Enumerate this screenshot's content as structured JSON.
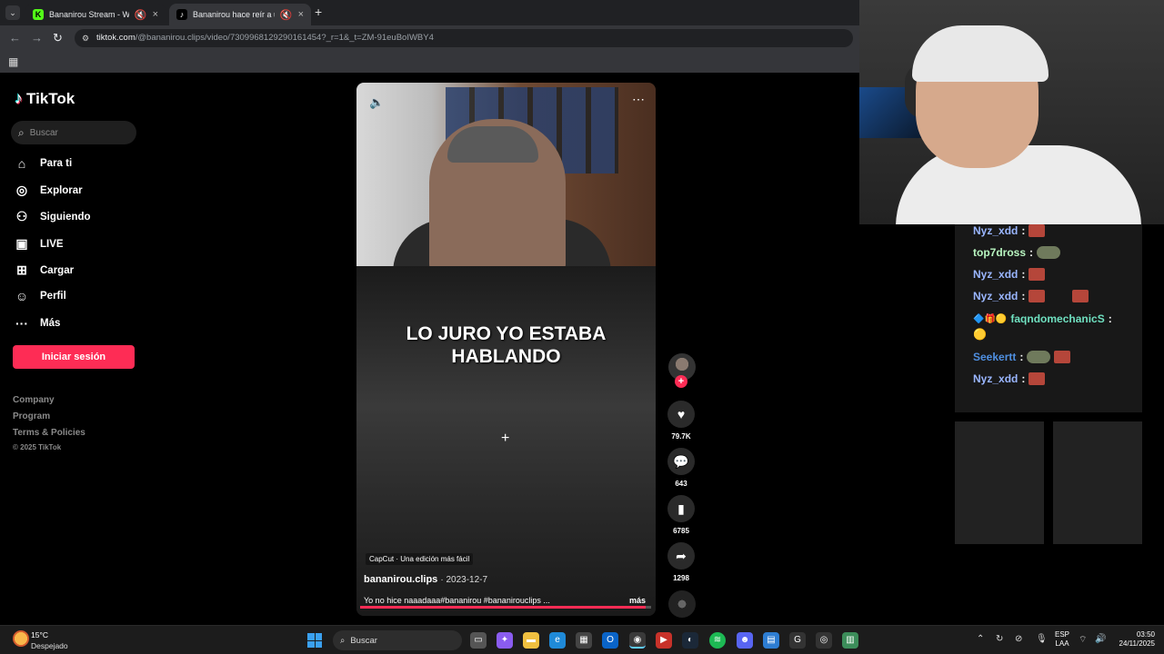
{
  "browser": {
    "tabs": [
      {
        "title": "Bananirou Stream - Watch Li",
        "icon": "kick-icon",
        "muted": true
      },
      {
        "title": "Bananirou hace reír a una c",
        "icon": "tiktok-icon",
        "muted": true
      }
    ],
    "url_host": "tiktok.com",
    "url_path": "/@bananirou.clips/video/7309968129290161454?_r=1&_t=ZM-91euBoIWBY4"
  },
  "tiktok": {
    "brand": "TikTok",
    "search_placeholder": "Buscar",
    "nav": [
      {
        "label": "Para ti",
        "icon": "home-icon"
      },
      {
        "label": "Explorar",
        "icon": "compass-icon"
      },
      {
        "label": "Siguiendo",
        "icon": "following-icon"
      },
      {
        "label": "LIVE",
        "icon": "live-icon"
      },
      {
        "label": "Cargar",
        "icon": "upload-icon"
      },
      {
        "label": "Perfil",
        "icon": "profile-icon"
      },
      {
        "label": "Más",
        "icon": "more-icon"
      }
    ],
    "login_label": "Iniciar sesión",
    "footer": [
      "Company",
      "Program",
      "Terms & Policies"
    ],
    "copyright": "© 2025 TikTok",
    "video": {
      "overlay_text_1": "LO JURO YO ESTABA",
      "overlay_text_2": "HABLANDO",
      "capcut": "CapCut · Una edición más fácil",
      "username": "bananirou.clips",
      "date": "· 2023-12-7",
      "description": "Yo no hice naaadaaa#bananirou #bananirouclips ...",
      "more": "más",
      "progress": 0.98
    },
    "actions": {
      "likes": "79.7K",
      "comments": "643",
      "saves": "6785",
      "shares": "1298"
    }
  },
  "chat": {
    "messages": [
      {
        "user": "Nyz_xdd",
        "color": "#9ab6ff",
        "sep": ":"
      },
      {
        "user": "top7dross",
        "color": "#b8f5c0",
        "sep": ":"
      },
      {
        "user": "Nyz_xdd",
        "color": "#9ab6ff",
        "sep": ":"
      },
      {
        "user": "Nyz_xdd",
        "color": "#9ab6ff",
        "sep": ":"
      },
      {
        "user": "faqndomechanicS",
        "color": "#6fe0c0",
        "sep": ":"
      },
      {
        "user": "Seekertt",
        "color": "#4f8fe0",
        "sep": ":"
      },
      {
        "user": "Nyz_xdd",
        "color": "#9ab6ff",
        "sep": ":"
      }
    ]
  },
  "taskbar": {
    "temperature": "15°C",
    "weather": "Despejado",
    "search_label": "Buscar",
    "lang_1": "ESP",
    "lang_2": "LAA",
    "time": "03:50",
    "date": "24/11/2025"
  },
  "colors": {
    "accent": "#fe2c55",
    "background": "#000000"
  }
}
